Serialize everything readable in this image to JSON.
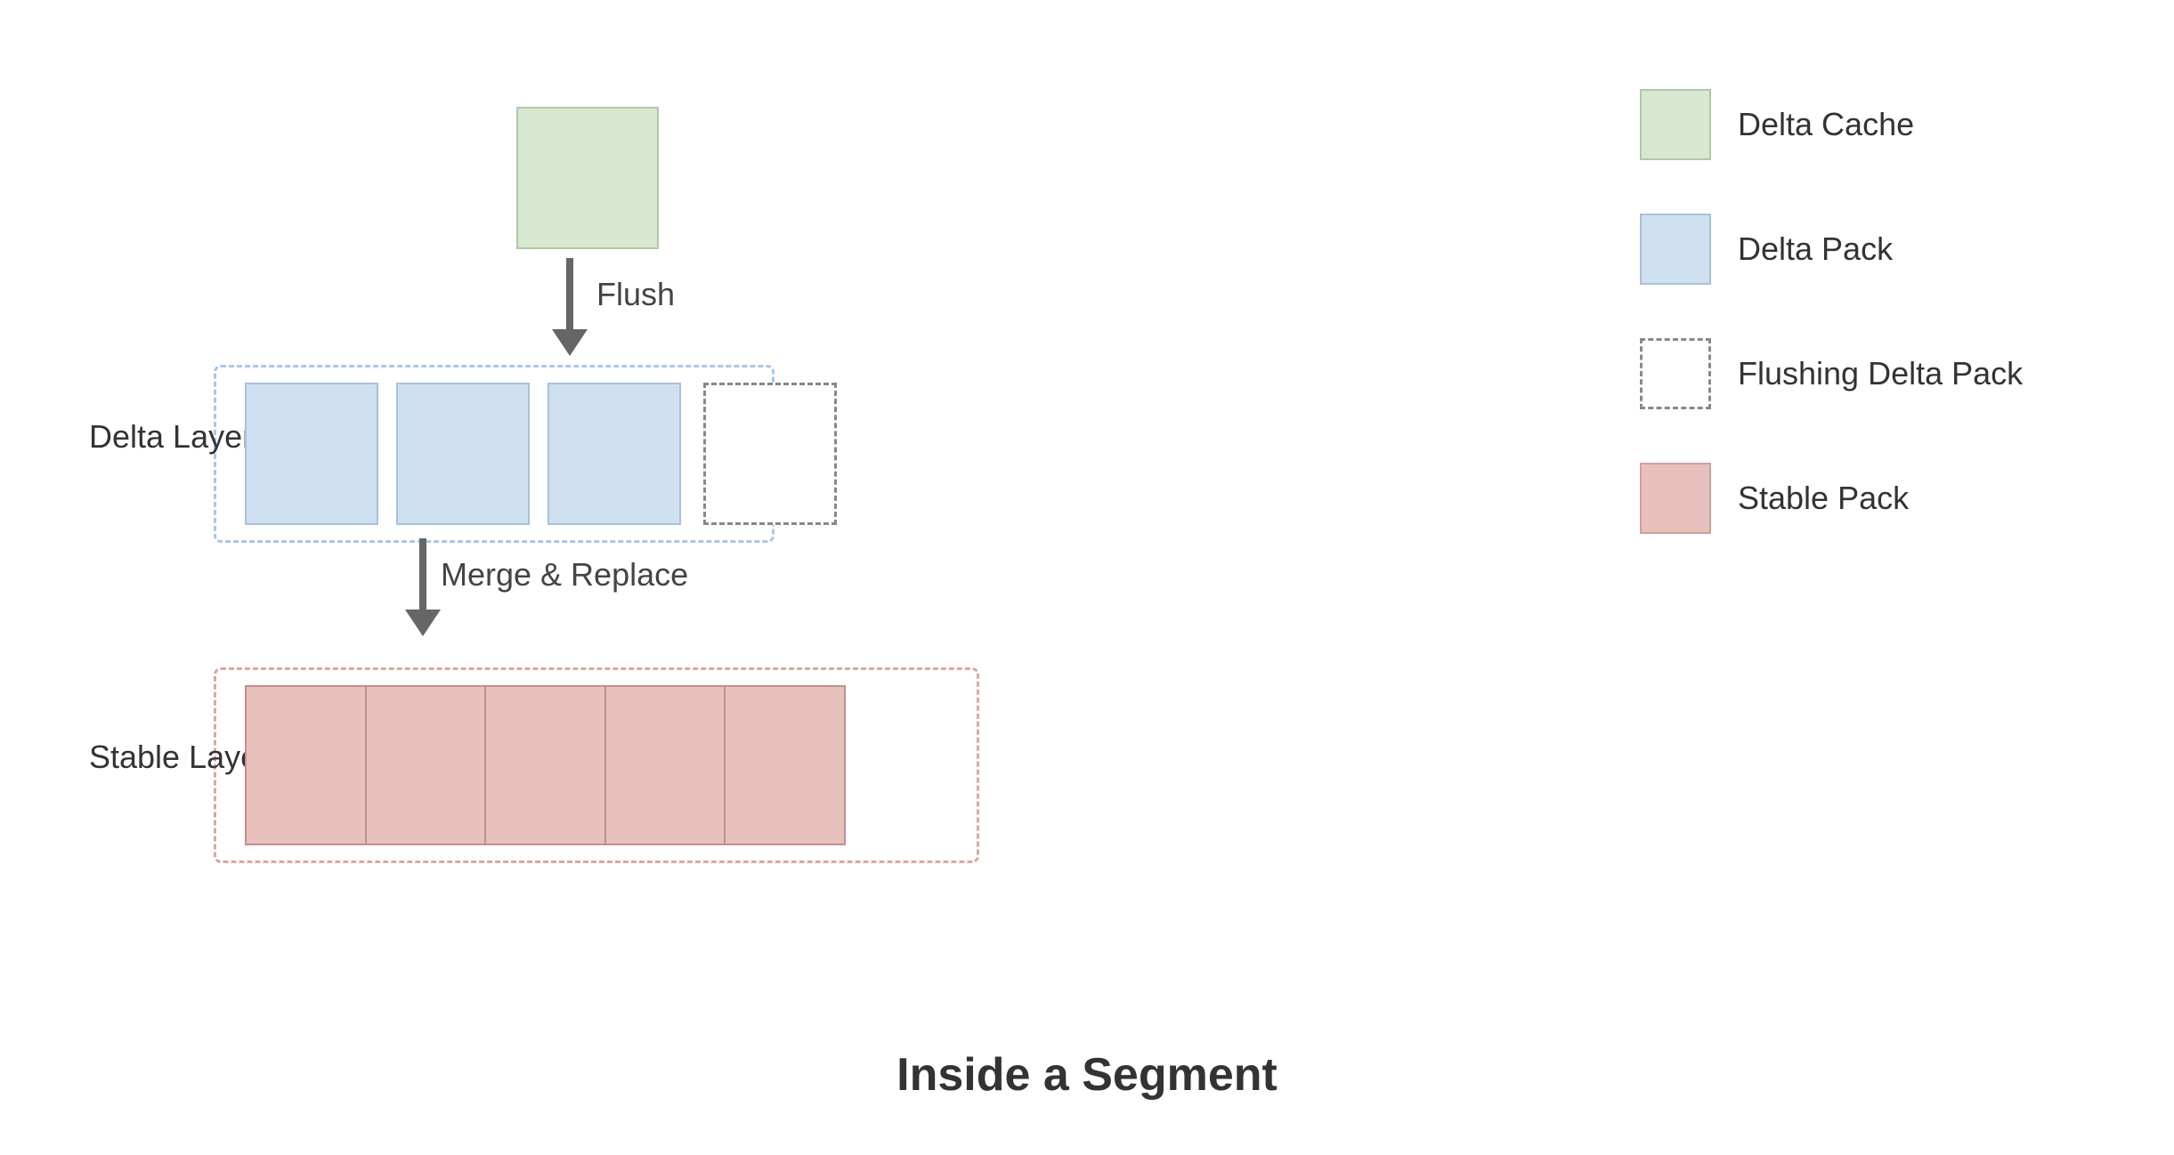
{
  "title": "Inside a Segment",
  "legend": {
    "items": [
      {
        "id": "delta-cache",
        "label": "Delta Cache"
      },
      {
        "id": "delta-pack",
        "label": "Delta Pack"
      },
      {
        "id": "flushing-delta-pack",
        "label": "Flushing Delta Pack"
      },
      {
        "id": "stable-pack",
        "label": "Stable Pack"
      }
    ]
  },
  "diagram": {
    "flush_label": "Flush",
    "merge_label": "Merge & Replace",
    "delta_layer_label": "Delta Layer",
    "stable_layer_label": "Stable Layer"
  },
  "colors": {
    "delta_cache_bg": "#d8e8d0",
    "delta_cache_border": "#b0c8a8",
    "delta_pack_bg": "#cfe0f0",
    "delta_pack_border": "#a8c0dc",
    "flushing_bg": "#ffffff",
    "flushing_border": "#888888",
    "stable_pack_bg": "#e8c0bc",
    "stable_pack_border": "#c09090",
    "arrow_color": "#666666"
  }
}
